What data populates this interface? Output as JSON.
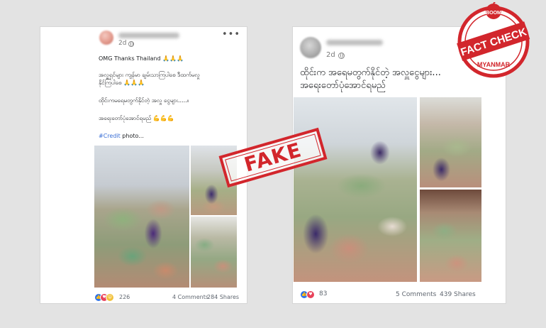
{
  "left_post": {
    "time": "2d",
    "more_icon": "ellipsis-icon",
    "privacy_icon": "globe-icon",
    "lines": [
      "OMG Thanks Thailand 🙏🙏🙏",
      "အလှူရှင်များ ကျန်မာ ချမ်းသာကြပါစေ ဒီထက်မလှူ",
      "နိုင်ကြပါစေ 🙏🙏🙏",
      "ထိုင်းကမရေမတွက်နိုင်တဲ့ အလှူ ငွေများ.....။",
      "အရေးတော်ပုံအောင်ရမည် 💪💪💪"
    ],
    "credit_link": "#Credit",
    "credit_rest": " photo...",
    "reaction_count": "226",
    "comments": "4 Comments",
    "shares": "284 Shares"
  },
  "right_post": {
    "time": "2d",
    "privacy_icon": "globe-icon",
    "more_icon": "ellipsis-icon",
    "line1": "ထိုင်းက အရေမတွက်နိုင်တဲ့ အလှူငွေများ...",
    "line2": "အရေးတော်ပုံအောင်ရမည်",
    "reaction_count": "83",
    "comments": "5 Comments",
    "shares": "439 Shares"
  },
  "stamp": {
    "text": "FAKE"
  },
  "logo": {
    "top": "BOOM",
    "middle": "FACT CHECK",
    "bottom": "MYANMAR"
  },
  "colors": {
    "stamp_red": "#d2262c",
    "link_blue": "#3a6fd6",
    "like_blue": "#2e73e8"
  }
}
